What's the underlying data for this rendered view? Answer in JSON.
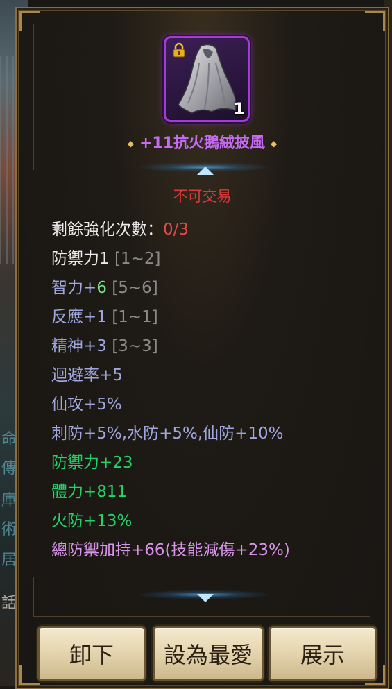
{
  "background": {
    "glyphs": [
      "命",
      "傳",
      "庫",
      "術",
      "居",
      "話"
    ]
  },
  "item": {
    "icon": "cloak-icon",
    "locked": true,
    "quantity": "1",
    "name": "+11抗火鵝絨披風",
    "rarity_color": "#c56bf2"
  },
  "trade_status": "不可交易",
  "stats": {
    "enhance": {
      "label": "剩餘強化次數：",
      "value": "0/3"
    },
    "defense": {
      "label": "防禦力1",
      "range": "[1~2]"
    },
    "int": {
      "label": "智力+",
      "value": "6",
      "range": "[5~6]"
    },
    "react": {
      "label": "反應+1",
      "range": "[1~1]"
    },
    "spirit": {
      "label": "精神+3",
      "range": "[3~3]"
    },
    "evade": {
      "text": "迴避率+5"
    },
    "xian_atk": {
      "text": "仙攻+5%"
    },
    "resist": {
      "text": "刺防+5%,水防+5%,仙防+10%"
    },
    "bonus_def": {
      "text": "防禦力+23"
    },
    "bonus_hp": {
      "text": "體力+811"
    },
    "bonus_fire": {
      "text": "火防+13%"
    },
    "total_def": {
      "text": "總防禦加持+66(技能減傷+23%)"
    }
  },
  "colors": {
    "white": "#eaeaea",
    "blue": "#9fa7de",
    "green": "#22d36a",
    "pink": "#d895ea",
    "red": "#e24a4a"
  },
  "buttons": {
    "unequip": "卸下",
    "favorite": "設為最愛",
    "show": "展示"
  }
}
